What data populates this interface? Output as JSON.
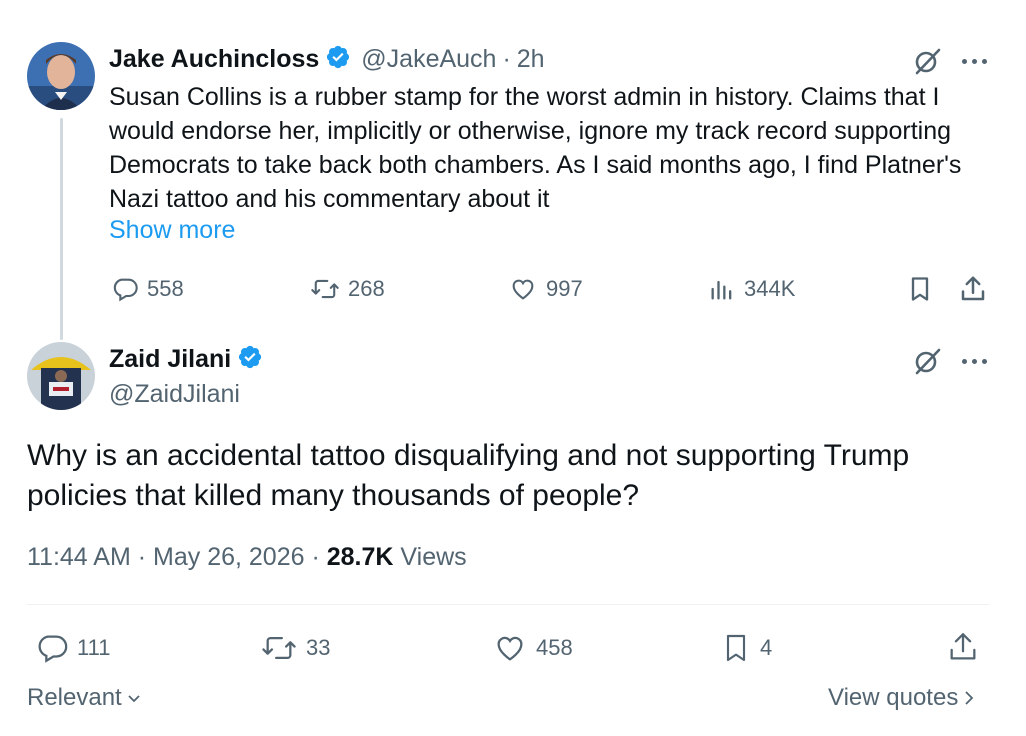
{
  "reply_to": {
    "author_name": "Jake Auchincloss",
    "handle": "@JakeAuch",
    "time_ago": "2h",
    "text": "Susan Collins is a rubber stamp for the worst admin in history. Claims that I would endorse her, implicitly or otherwise, ignore my track record supporting Democrats to take back both chambers. As I said months ago, I find Platner's Nazi tattoo and his commentary about it",
    "show_more_label": "Show more",
    "replies": "558",
    "reposts": "268",
    "likes": "997",
    "views": "344K"
  },
  "main_post": {
    "author_name": "Zaid Jilani",
    "handle": "@ZaidJilani",
    "text": "Why is an accidental tattoo disqualifying and not supporting Trump policies that killed many thousands of people?",
    "time": "11:44 AM",
    "date": "May 26, 2026",
    "views_count": "28.7K",
    "views_label": "Views",
    "replies": "111",
    "reposts": "33",
    "likes": "458",
    "bookmarks": "4"
  },
  "footer": {
    "sort_label": "Relevant",
    "view_quotes_label": "View quotes"
  },
  "colors": {
    "accent": "#1d9bf0",
    "muted": "#536471",
    "text": "#0f1419"
  }
}
